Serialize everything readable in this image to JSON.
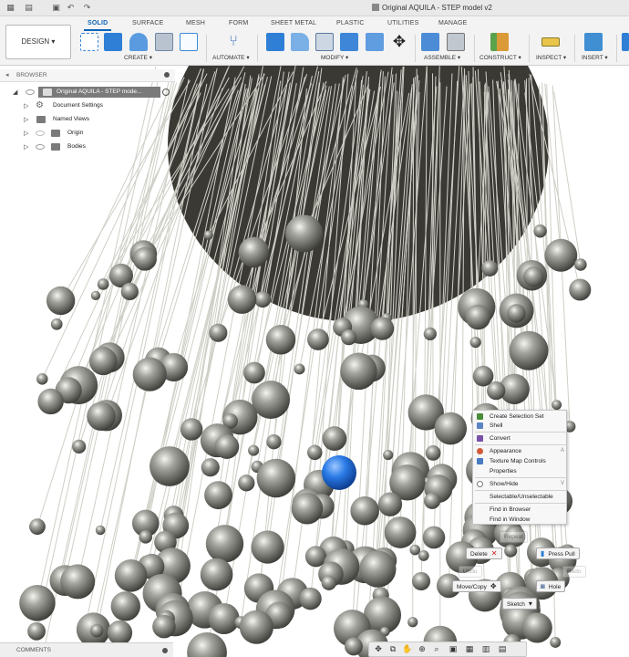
{
  "window": {
    "title": "Original AQUILA - STEP model v2"
  },
  "toolbar": {
    "workspace": "DESIGN",
    "tabs": [
      "SOLID",
      "SURFACE",
      "MESH",
      "FORM",
      "SHEET METAL",
      "PLASTIC",
      "UTILITIES",
      "MANAGE"
    ],
    "active_tab": "SOLID",
    "groups": [
      "CREATE",
      "AUTOMATE",
      "MODIFY",
      "ASSEMBLE",
      "CONSTRUCT",
      "INSPECT",
      "INSERT"
    ]
  },
  "browser": {
    "title": "BROWSER",
    "root": "Original AQUILA - STEP mode...",
    "items": [
      "Document Settings",
      "Named Views",
      "Origin",
      "Bodies"
    ]
  },
  "context_menu": {
    "items": [
      {
        "label": "Create Selection Set",
        "icon": "selection-set-icon",
        "color": "#4a8b3a"
      },
      {
        "label": "Shell",
        "icon": "shell-icon",
        "color": "#5a83c4"
      },
      {
        "label": "Convert",
        "icon": "convert-icon",
        "color": "#7a4fa8"
      },
      {
        "label": "Appearance",
        "icon": "appearance-icon",
        "color": "#d05a3a",
        "shortcut": "A"
      },
      {
        "label": "Texture Map Controls",
        "icon": "texture-icon",
        "color": "#4a7ac4"
      },
      {
        "label": "Properties",
        "icon": "",
        "color": ""
      },
      {
        "label": "Show/Hide",
        "icon": "eye-icon",
        "color": "#777777",
        "shortcut": "V"
      },
      {
        "label": "Selectable/Unselectable",
        "icon": "",
        "color": ""
      },
      {
        "label": "Find in Browser",
        "icon": "",
        "color": ""
      },
      {
        "label": "Find in Window",
        "icon": "",
        "color": ""
      }
    ]
  },
  "marking_menu": {
    "delete": "Delete",
    "press_pull": "Press Pull",
    "move_copy": "Move/Copy",
    "hole": "Hole",
    "sketch": "Sketch",
    "ghost_undo": "Undo",
    "ghost_redo": "Redo",
    "ghost_repeat": "Repeat"
  },
  "comments": {
    "title": "COMMENTS"
  },
  "colors": {
    "accent": "#0a64b5",
    "disc": "#3a3934",
    "sphere": "#8c8c86",
    "rod": "#cfcfc7",
    "selected_sphere": "#1f6fe0"
  }
}
